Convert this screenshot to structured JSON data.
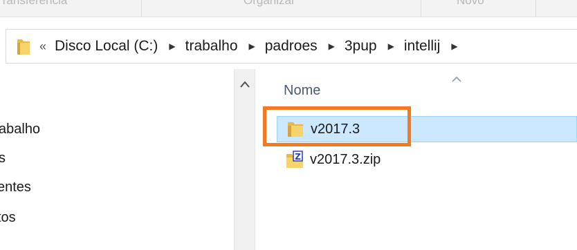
{
  "ribbon": {
    "tabs": [
      "Transferência",
      "Organizar",
      "Novo"
    ]
  },
  "address": {
    "overflow_glyph": "«",
    "crumbs": [
      "Disco Local (C:)",
      "trabalho",
      "padroes",
      "3pup",
      "intellij"
    ]
  },
  "nav": {
    "items": [
      "abalho",
      "s",
      "entes",
      "tos"
    ]
  },
  "list": {
    "column_name": "Nome",
    "files": [
      {
        "name": "v2017.3",
        "kind": "folder",
        "selected": true
      },
      {
        "name": "v2017.3.zip",
        "kind": "zip",
        "selected": false
      }
    ]
  },
  "colors": {
    "selection_bg": "#cce8ff",
    "selection_border": "#99d1ff",
    "annotation": "#f47920"
  }
}
